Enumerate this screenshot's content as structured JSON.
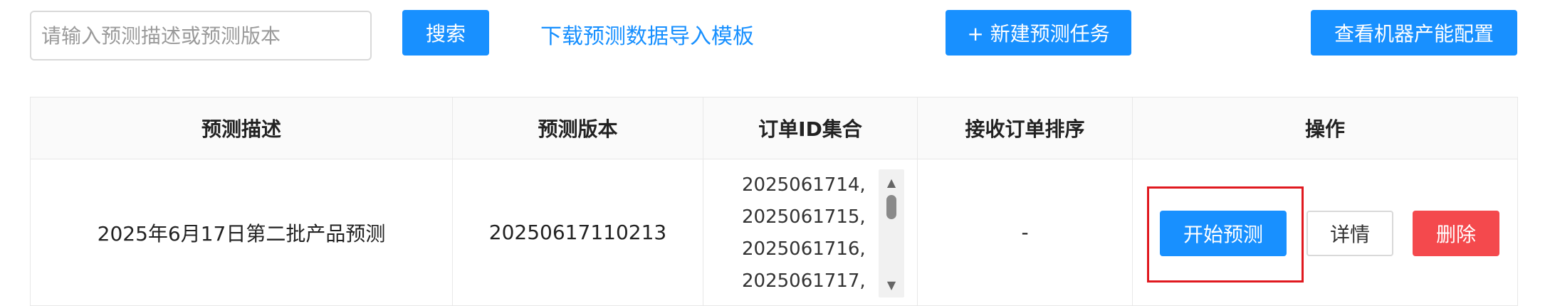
{
  "toolbar": {
    "search_placeholder": "请输入预测描述或预测版本",
    "search_value": "",
    "search_button": "搜索",
    "download_link": "下载预测数据导入模板",
    "new_task_button": "+ 新建预测任务",
    "view_config_button": "查看机器产能配置"
  },
  "table": {
    "columns": [
      "预测描述",
      "预测版本",
      "订单ID集合",
      "接收订单排序",
      "操作"
    ],
    "rows": [
      {
        "description": "2025年6月17日第二批产品预测",
        "version": "20250617110213",
        "order_ids": [
          "2025061714,",
          "2025061715,",
          "2025061716,",
          "2025061717,"
        ],
        "order_sort": "-",
        "actions": {
          "start": "开始预测",
          "detail": "详情",
          "delete": "删除"
        }
      }
    ]
  },
  "colors": {
    "primary": "#1890ff",
    "danger": "#f4494d",
    "highlight_border": "#e0191f",
    "header_bg": "#fafafa"
  },
  "icons": {
    "scroll_up": "triangle-up-icon",
    "scroll_down": "triangle-down-icon"
  }
}
